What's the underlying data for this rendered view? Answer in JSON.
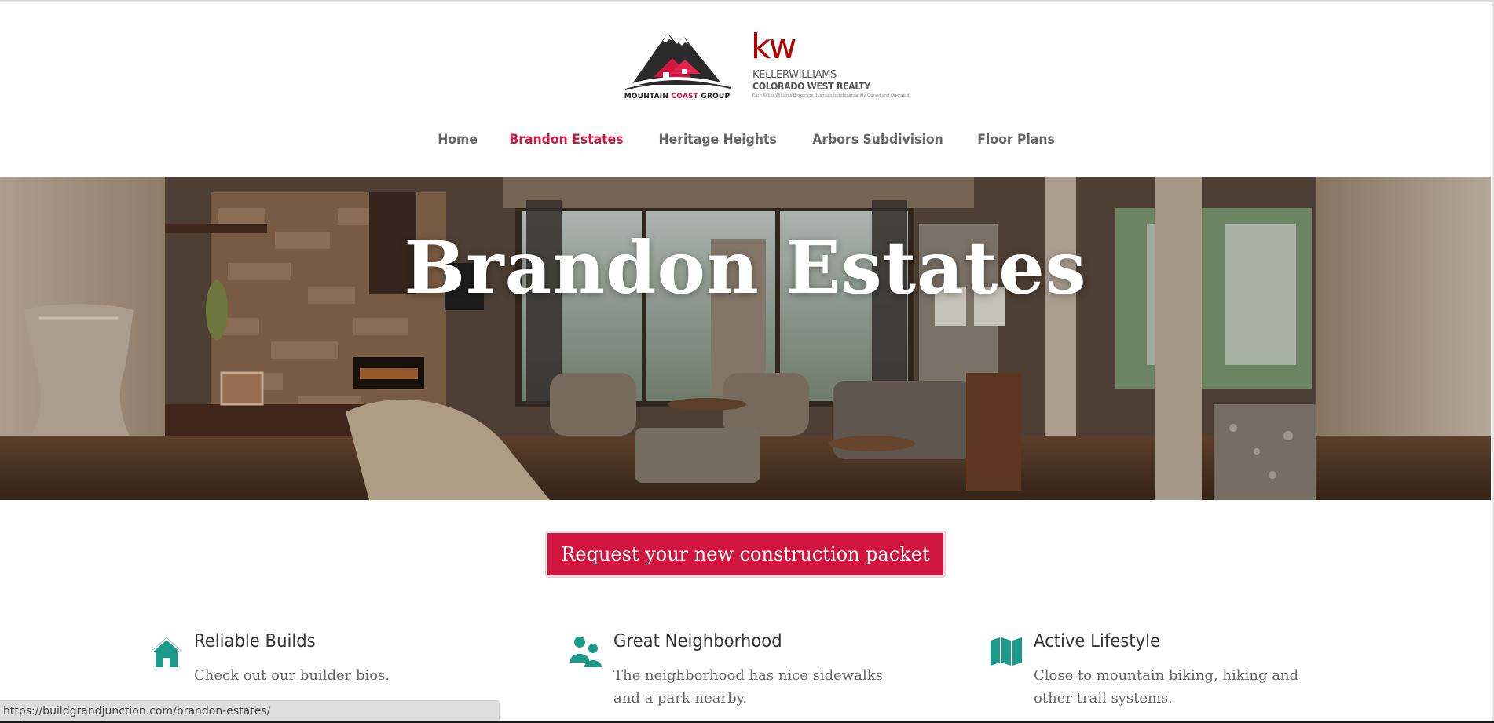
{
  "logos": {
    "left_brand_part1": "MOUNTAIN ",
    "left_brand_part2": "COAST",
    "left_brand_part3": " GROUP",
    "right_mark": "kw",
    "right_line1": "KELLERWILLIAMS",
    "right_line2": "COLORADO WEST REALTY",
    "right_line3": "Each Keller Williams Brokerage Business Is Independently Owned and Operated"
  },
  "nav": {
    "items": [
      {
        "label": "Home"
      },
      {
        "label": "Brandon Estates"
      },
      {
        "label": "Heritage Heights"
      },
      {
        "label": "Arbors Subdivision"
      },
      {
        "label": "Floor Plans"
      }
    ]
  },
  "hero": {
    "title": "Brandon Estates"
  },
  "cta": {
    "label": "Request your new construction packet"
  },
  "features": [
    {
      "icon": "home-icon",
      "title": "Reliable Builds",
      "text": "Check out our builder bios."
    },
    {
      "icon": "people-icon",
      "title": "Great Neighborhood",
      "text": "The neighborhood has nice sidewalks and a park nearby."
    },
    {
      "icon": "map-icon",
      "title": "Active Lifestyle",
      "text": "Close to mountain biking, hiking and other trail systems."
    }
  ],
  "status_bar": {
    "url": "https://buildgrandjunction.com/brandon-estates/"
  },
  "colors": {
    "accent": "#d0163e",
    "icon_teal": "#1a9a8a",
    "nav_text": "#666666"
  }
}
